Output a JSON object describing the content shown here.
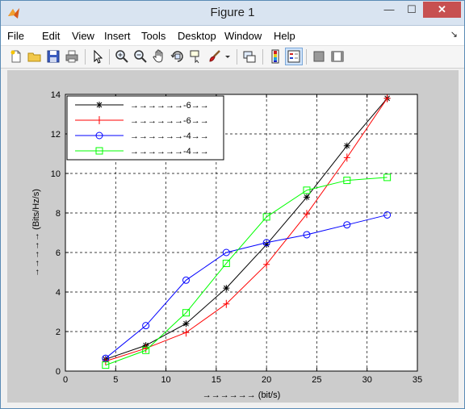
{
  "window": {
    "title": "Figure 1",
    "min_label": "—",
    "max_label": "☐",
    "close_label": "✕"
  },
  "menu": {
    "items": [
      "File",
      "Edit",
      "View",
      "Insert",
      "Tools",
      "Desktop",
      "Window",
      "Help"
    ],
    "dock_arrow": "↘"
  },
  "toolbar": {
    "icons": [
      "new-figure-icon",
      "open-file-icon",
      "save-icon",
      "print-icon",
      "edit-plot-icon",
      "zoom-in-icon",
      "zoom-out-icon",
      "pan-icon",
      "rotate-3d-icon",
      "data-cursor-icon",
      "brush-icon",
      "brush-dropdown-icon",
      "link-plot-icon",
      "insert-colorbar-icon",
      "insert-legend-icon",
      "hide-plot-tools-icon",
      "show-plot-tools-icon"
    ]
  },
  "colors": {
    "series_1": "#000000",
    "series_2": "#ff0000",
    "series_3": "#0000ff",
    "series_4": "#00ff00",
    "figure_bg": "#cccccc",
    "axes_bg": "#ffffff"
  },
  "chart_data": {
    "type": "line",
    "title": "",
    "xlabel": "→→→→→→ (bit/s)",
    "ylabel": "→→→→→ (Bits/Hz/s)",
    "xlim": [
      0,
      35
    ],
    "ylim": [
      0,
      14
    ],
    "xticks": [
      0,
      5,
      10,
      15,
      20,
      25,
      30,
      35
    ],
    "yticks": [
      0,
      2,
      4,
      6,
      8,
      10,
      12,
      14
    ],
    "grid": true,
    "legend_position": "top-left",
    "series": [
      {
        "name": "→→→→→→-6→→",
        "color": "#000000",
        "marker": "star",
        "x": [
          4,
          8,
          12,
          16,
          20,
          24,
          28,
          32
        ],
        "y": [
          0.6,
          1.3,
          2.4,
          4.2,
          6.4,
          8.8,
          11.4,
          13.8
        ]
      },
      {
        "name": "→→→→→→-6→→",
        "color": "#ff0000",
        "marker": "plus",
        "x": [
          4,
          8,
          12,
          16,
          20,
          24,
          28,
          32
        ],
        "y": [
          0.5,
          1.15,
          1.95,
          3.4,
          5.4,
          7.95,
          10.8,
          13.8
        ]
      },
      {
        "name": "→→→→→→-4→→",
        "color": "#0000ff",
        "marker": "circle",
        "x": [
          4,
          8,
          12,
          16,
          20,
          24,
          28,
          32
        ],
        "y": [
          0.65,
          2.3,
          4.6,
          6.0,
          6.5,
          6.9,
          7.4,
          7.9
        ]
      },
      {
        "name": "→→→→→→-4→→",
        "color": "#00ff00",
        "marker": "square",
        "x": [
          4,
          8,
          12,
          16,
          20,
          24,
          28,
          32
        ],
        "y": [
          0.3,
          1.05,
          2.95,
          5.45,
          7.8,
          9.15,
          9.65,
          9.8
        ]
      }
    ]
  }
}
